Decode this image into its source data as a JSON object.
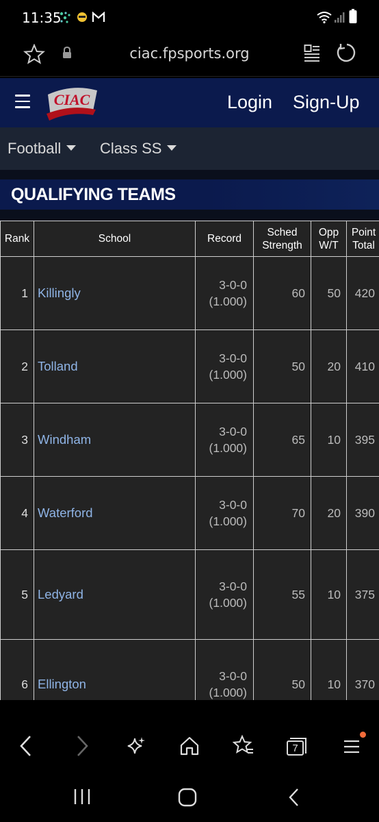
{
  "status": {
    "time": "11:35"
  },
  "browser": {
    "url": "ciac.fpsports.org",
    "tab_count": "7"
  },
  "header": {
    "logo_text": "CIAC",
    "login": "Login",
    "signup": "Sign-Up"
  },
  "filters": {
    "sport": "Football",
    "class": "Class SS"
  },
  "section": {
    "title": "QUALIFYING TEAMS"
  },
  "table": {
    "columns": [
      {
        "label": "Rank"
      },
      {
        "label": "School"
      },
      {
        "label": "Record"
      },
      {
        "label": "Sched Strength"
      },
      {
        "label": "Opp W/T"
      },
      {
        "label": "Point Total"
      }
    ],
    "rows": [
      {
        "rank": "1",
        "school": "Killingly",
        "record": "3-0-0",
        "pct": "(1.000)",
        "sched": "60",
        "opp": "50",
        "points": "420"
      },
      {
        "rank": "2",
        "school": "Tolland",
        "record": "3-0-0",
        "pct": "(1.000)",
        "sched": "50",
        "opp": "20",
        "points": "410"
      },
      {
        "rank": "3",
        "school": "Windham",
        "record": "3-0-0",
        "pct": "(1.000)",
        "sched": "65",
        "opp": "10",
        "points": "395"
      },
      {
        "rank": "4",
        "school": "Waterford",
        "record": "3-0-0",
        "pct": "(1.000)",
        "sched": "70",
        "opp": "20",
        "points": "390"
      },
      {
        "rank": "5",
        "school": "Ledyard",
        "record": "3-0-0",
        "pct": "(1.000)",
        "sched": "55",
        "opp": "10",
        "points": "375"
      },
      {
        "rank": "6",
        "school": "Ellington",
        "record": "3-0-0",
        "pct": "(1.000)",
        "sched": "50",
        "opp": "10",
        "points": "370"
      }
    ]
  },
  "colors": {
    "header_bg": "#0b1a4d",
    "link": "#8fb4e6",
    "notification_dot": "#f26b3a"
  }
}
